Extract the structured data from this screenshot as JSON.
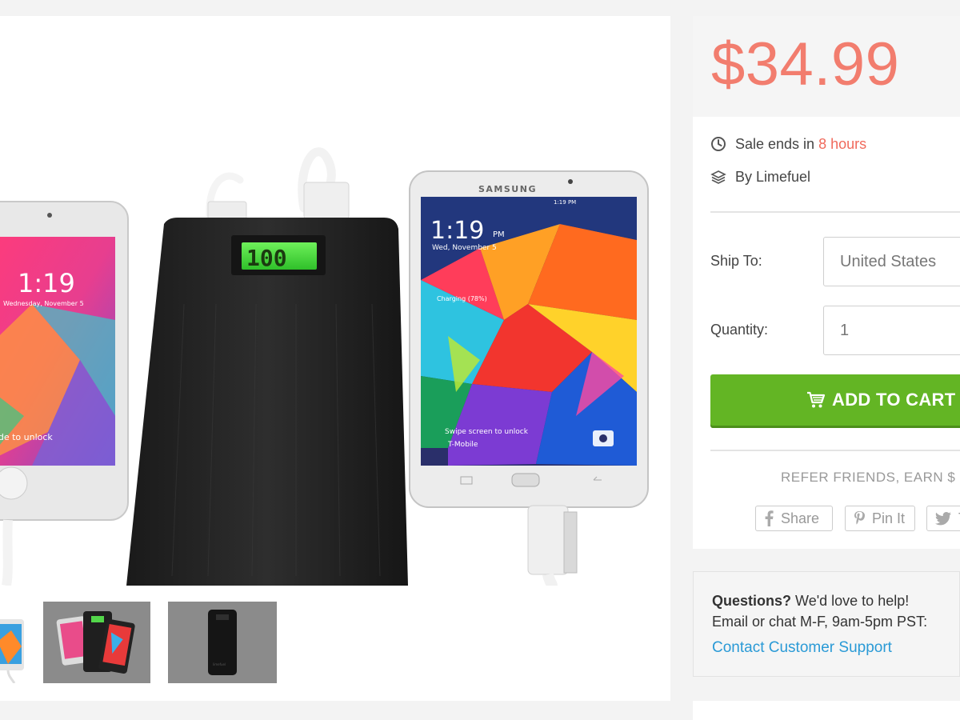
{
  "product": {
    "price": "$34.99",
    "sale": {
      "prefix": "Sale ends in",
      "highlight": "8 hours"
    },
    "brand": "By Limefuel"
  },
  "shipping": {
    "label": "Ship To:",
    "value": "United States"
  },
  "quantity": {
    "label": "Quantity:",
    "value": "1"
  },
  "cart": {
    "label": "ADD TO CART"
  },
  "referral": {
    "text": "REFER FRIENDS, EARN $"
  },
  "share": [
    {
      "label": "Share",
      "icon": "facebook-icon"
    },
    {
      "label": "Pin It",
      "icon": "pinterest-icon"
    },
    {
      "label": "T",
      "icon": "twitter-icon"
    }
  ],
  "help": {
    "question_bold": "Questions?",
    "question_rest": "We'd love to help!",
    "hours": "Email or chat M-F, 9am-5pm PST:",
    "contact_link": "Contact Customer Support"
  },
  "hero_image": {
    "power_bank_display": "100",
    "iphone_time": "1:19",
    "iphone_date": "Wednesday, November 5",
    "iphone_unlock": "slide to unlock",
    "samsung_brand": "SAMSUNG",
    "samsung_time": "1:19",
    "samsung_time_suffix": "PM",
    "samsung_date": "Wed, November 5",
    "samsung_charging": "Charging (78%)",
    "samsung_swipe": "Swipe screen to unlock",
    "samsung_carrier": "T-Mobile",
    "samsung_status_time": "1:19 PM"
  },
  "colors": {
    "price": "#f27d6e",
    "cta": "#63b524",
    "link": "#2a9ad6",
    "highlight": "#f06a5c"
  }
}
